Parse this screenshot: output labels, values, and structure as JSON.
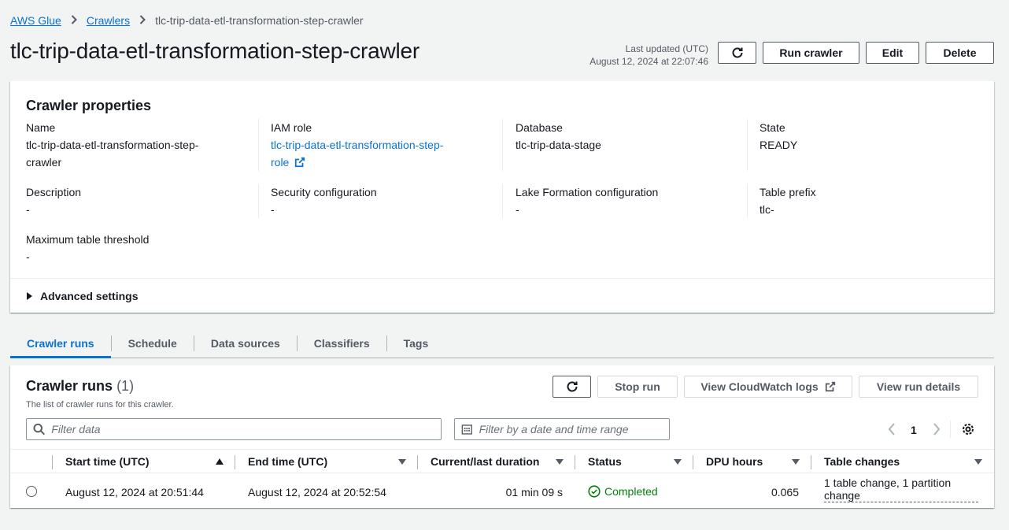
{
  "breadcrumb": [
    {
      "label": "AWS Glue"
    },
    {
      "label": "Crawlers"
    },
    {
      "label": "tlc-trip-data-etl-transformation-step-crawler"
    }
  ],
  "header": {
    "title": "tlc-trip-data-etl-transformation-step-crawler",
    "last_updated_label": "Last updated (UTC)",
    "last_updated_value": "August 12, 2024 at 22:07:46",
    "run_label": "Run crawler",
    "edit_label": "Edit",
    "delete_label": "Delete"
  },
  "properties": {
    "title": "Crawler properties",
    "name_label": "Name",
    "name_value_line1": "tlc-trip-data-etl-transformation-step-",
    "name_value_line2": "crawler",
    "iam_label": "IAM role",
    "iam_value_line1": "tlc-trip-data-etl-transformation-step-",
    "iam_value_line2": "role",
    "database_label": "Database",
    "database_value": "tlc-trip-data-stage",
    "state_label": "State",
    "state_value": "READY",
    "description_label": "Description",
    "description_value": "-",
    "security_label": "Security configuration",
    "security_value": "-",
    "lake_label": "Lake Formation configuration",
    "lake_value": "-",
    "prefix_label": "Table prefix",
    "prefix_value": "tlc-",
    "threshold_label": "Maximum table threshold",
    "threshold_value": "-",
    "advanced_label": "Advanced settings"
  },
  "tabs": [
    {
      "label": "Crawler runs",
      "active": true
    },
    {
      "label": "Schedule",
      "active": false
    },
    {
      "label": "Data sources",
      "active": false
    },
    {
      "label": "Classifiers",
      "active": false
    },
    {
      "label": "Tags",
      "active": false
    }
  ],
  "runs": {
    "title": "Crawler runs",
    "count": "(1)",
    "description": "The list of crawler runs for this crawler.",
    "stop_label": "Stop run",
    "cloudwatch_label": "View CloudWatch logs",
    "details_label": "View run details",
    "filter_placeholder": "Filter data",
    "date_filter_placeholder": "Filter by a date and time range",
    "page_number": "1",
    "columns": {
      "start": "Start time (UTC)",
      "end": "End time (UTC)",
      "duration": "Current/last duration",
      "status": "Status",
      "dpu": "DPU hours",
      "changes": "Table changes"
    },
    "rows": [
      {
        "start": "August 12, 2024 at 20:51:44",
        "end": "August 12, 2024 at 20:52:54",
        "duration": "01 min 09 s",
        "status": "Completed",
        "dpu": "0.065",
        "changes_line1": "1 table change, 1 partition",
        "changes_line2": "change"
      }
    ]
  },
  "colors": {
    "link": "#0972d3",
    "success": "#037f0c",
    "background": "#f2f3f3"
  }
}
